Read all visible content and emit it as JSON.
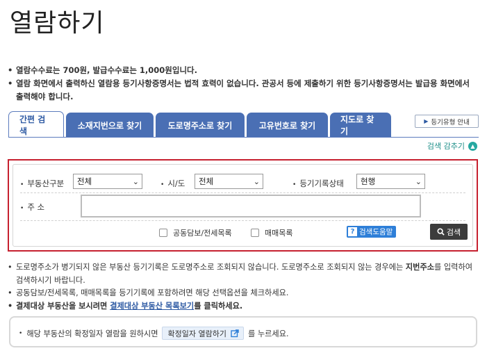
{
  "page": {
    "title": "열람하기"
  },
  "notices": [
    "열람수수료는 700원, 발급수수료는 1,000원입니다.",
    "열람 화면에서 출력하신 열람용 등기사항증명서는 법적 효력이 없습니다. 관공서 등에 제출하기 위한 등기사항증명서는 발급용 화면에서 출력해야 합니다."
  ],
  "tabs": [
    "간편 검색",
    "소재지번으로 찾기",
    "도로명주소로 찾기",
    "고유번호로 찾기",
    "지도로 찾기"
  ],
  "guide_button": "등기유형 안내",
  "collapse_label": "검색 감추기",
  "form": {
    "property_type": {
      "label": "부동산구분",
      "value": "전체"
    },
    "region": {
      "label": "시/도",
      "value": "전체"
    },
    "record_status": {
      "label": "등기기록상태",
      "value": "현행"
    },
    "address": {
      "label": "주 소",
      "value": ""
    },
    "checkbox_joint": "공동담보/전세목록",
    "checkbox_sale": "매매목록",
    "help_button": "검색도움말",
    "search_button": "검색"
  },
  "tips": {
    "tip1_a": "도로명주소가 병기되지 않은 부동산 등기기록은 도로명주소로 조회되지 않습니다. 도로명주소로 조회되지 않는 경우에는 ",
    "tip1_bold": "지번주소",
    "tip1_b": "를 입력하여 검색하시기 바랍니다.",
    "tip2": "공동담보/전세목록, 매매목록을 등기기록에 포함하려면 해당 선택옵션을 체크하세요.",
    "tip3_a": "결제대상 부동산을 보시려면 ",
    "tip3_link": "결제대상 부동산 목록보기",
    "tip3_b": "를 클릭하세요."
  },
  "confirm": {
    "text_a": "해당 부동산의 확정일자 열람을 원하시면",
    "button": "확정일자 열람하기",
    "text_b": "를 누르세요."
  }
}
